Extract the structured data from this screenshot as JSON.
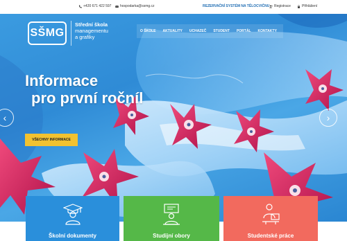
{
  "topbar": {
    "phone": "+420 671 422 597",
    "email": "hospodarka@ssmg.cz",
    "reservation": "REZERVAČNÍ SYSTÉM NA TĚLOCVIČNU",
    "register": "Registrace",
    "login": "Přihlášení"
  },
  "header": {
    "logo_text": "SŠMG",
    "school_name": [
      "Střední škola",
      "managementu",
      "a grafiky"
    ]
  },
  "nav": {
    "items": [
      "O ŠKOLE",
      "AKTUALITY",
      "UCHAZEČ",
      "STUDENT",
      "PORTÁL",
      "KONTAKTY"
    ]
  },
  "hero": {
    "headline": [
      "Informace",
      "pro první ročníl"
    ],
    "cta_label": "VŠECHNY INFORMACE",
    "prev_glyph": "‹",
    "next_glyph": "›"
  },
  "cards": [
    {
      "label": "Školní dokumenty",
      "color": "#2a8fdb",
      "icon": "graduate-icon"
    },
    {
      "label": "Studijní obory",
      "color": "#55b848",
      "icon": "teacher-board-icon"
    },
    {
      "label": "Studentské práce",
      "color": "#f26a5e",
      "icon": "student-computer-icon"
    }
  ],
  "colors": {
    "accent_blue": "#1f6db3",
    "cta_yellow": "#f2c230",
    "flower_magenta": "#d6245f"
  }
}
